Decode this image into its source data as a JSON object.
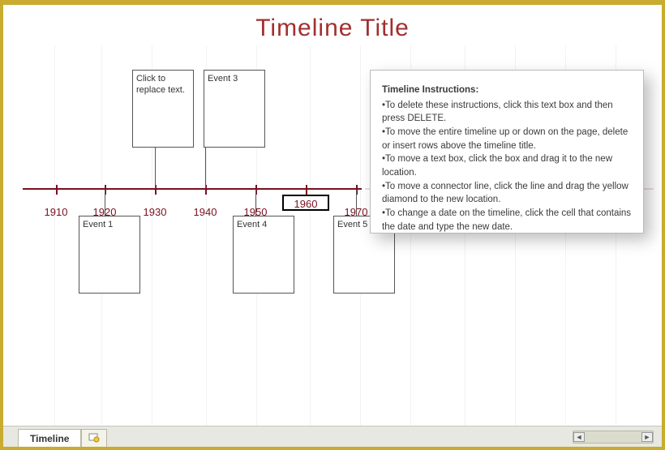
{
  "title": "Timeline Title",
  "chart_data": {
    "type": "bar",
    "categories": [
      "1910",
      "1920",
      "1930",
      "1940",
      "1950",
      "1960",
      "1970"
    ],
    "values": [
      0,
      0,
      0,
      0,
      0,
      0,
      0
    ],
    "title": "Timeline Title",
    "xlabel": "",
    "ylabel": "",
    "ylim": [
      0,
      1
    ],
    "events_above": [
      {
        "year": "1930",
        "label": "Click to replace text."
      },
      {
        "year": "1940",
        "label": "Event 3"
      }
    ],
    "events_below": [
      {
        "year": "1920",
        "label": "Event 1"
      },
      {
        "year": "1950",
        "label": "Event 4"
      },
      {
        "year": "1970",
        "label": "Event 5"
      }
    ],
    "selected_year": "1960"
  },
  "years": {
    "0": "1910",
    "1": "1920",
    "2": "1930",
    "3": "1940",
    "4": "1950",
    "5": "1960",
    "6": "1970"
  },
  "events": {
    "above_0": "Click to replace text.",
    "above_1": "Event 3",
    "below_0": "Event 1",
    "below_1": "Event 4",
    "below_2": "Event 5"
  },
  "instructions": {
    "head": "Timeline Instructions:",
    "b0": "•To delete these instructions, click this text box and then press DELETE.",
    "b1": "•To move the entire timeline up or down on the page, delete or insert rows above the timeline title.",
    "b2": "•To move a text box, click the box and drag it to the new location.",
    "b3": "•To move a connector line, click the line and drag the yellow diamond to the new location.",
    "b4": "•To change a date on the timeline, click the cell that contains the date and type the new date."
  },
  "tab": {
    "active": "Timeline"
  }
}
